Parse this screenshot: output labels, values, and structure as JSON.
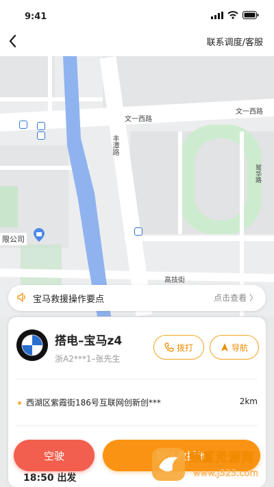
{
  "status_bar": {
    "time": "9:41"
  },
  "header": {
    "right_link": "联系调度/客服"
  },
  "map": {
    "streets": [
      "文一西路",
      "文一西路",
      "丰潭路",
      "高技街",
      "鹫华路"
    ],
    "company_label": "限公司"
  },
  "notice": {
    "text": "宝马救援操作要点",
    "link": "点击查看 〉"
  },
  "order": {
    "title": "搭电–宝马z4",
    "subtitle": "浙A2***1–张先生",
    "call_label": "拨打",
    "nav_label": "导航",
    "address": "西湖区紫霞街186号互联网创新创***",
    "distance": "2km",
    "time_label": "18:50  出发"
  },
  "actions": {
    "empty_label": "空驶",
    "main_label": "到达救援地"
  },
  "watermark": {
    "title": "鲸夏资源网",
    "url": "www.j323.com"
  },
  "colors": {
    "accent": "#fa9313",
    "danger": "#f25f4e",
    "river": "#8fb3ef"
  }
}
